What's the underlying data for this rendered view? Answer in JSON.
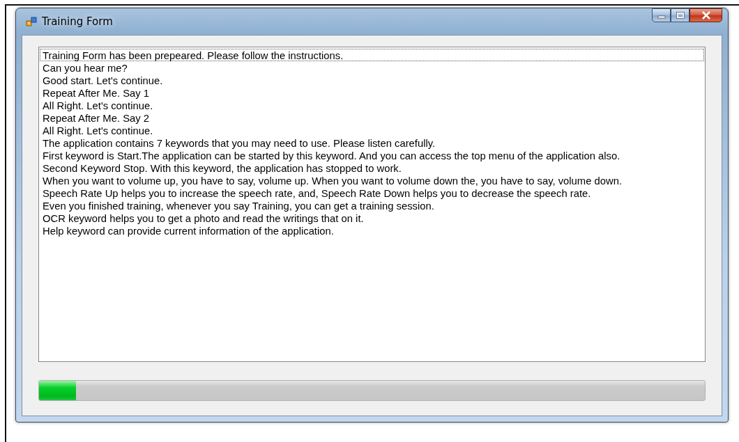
{
  "window": {
    "title": "Training Form"
  },
  "list": {
    "items": [
      {
        "text": "Training Form has been prepeared. Please follow the instructions.",
        "focused": true
      },
      {
        "text": "Can you hear me?",
        "focused": false
      },
      {
        "text": "Good start. Let's continue.",
        "focused": false
      },
      {
        "text": "Repeat After Me. Say 1",
        "focused": false
      },
      {
        "text": "All Right. Let's continue.",
        "focused": false
      },
      {
        "text": "Repeat After Me. Say 2",
        "focused": false
      },
      {
        "text": "All Right. Let's continue.",
        "focused": false
      },
      {
        "text": "The application contains 7 keywords that you may need to use. Please listen carefully.",
        "focused": false
      },
      {
        "text": "First keyword is Start.The application can be started by this keyword. And you can access the top menu of the application also.",
        "focused": false
      },
      {
        "text": "Second Keyword Stop. With this keyword, the application has stopped to work.",
        "focused": false
      },
      {
        "text": "When you want to volume up, you have to say, volume up. When you want to volume down the, you have to say, volume down.",
        "focused": false
      },
      {
        "text": "Speech Rate Up helps you to increase the speech rate, and, Speech Rate Down helps you to decrease the speech rate.",
        "focused": false
      },
      {
        "text": "Even you finished training, whenever you say Training, you can get a training session.",
        "focused": false
      },
      {
        "text": "OCR keyword helps you to get a photo and read the writings that on it.",
        "focused": false
      },
      {
        "text": "Help keyword can provide current information of the application.",
        "focused": false
      }
    ]
  },
  "progress": {
    "level": 0.056
  }
}
